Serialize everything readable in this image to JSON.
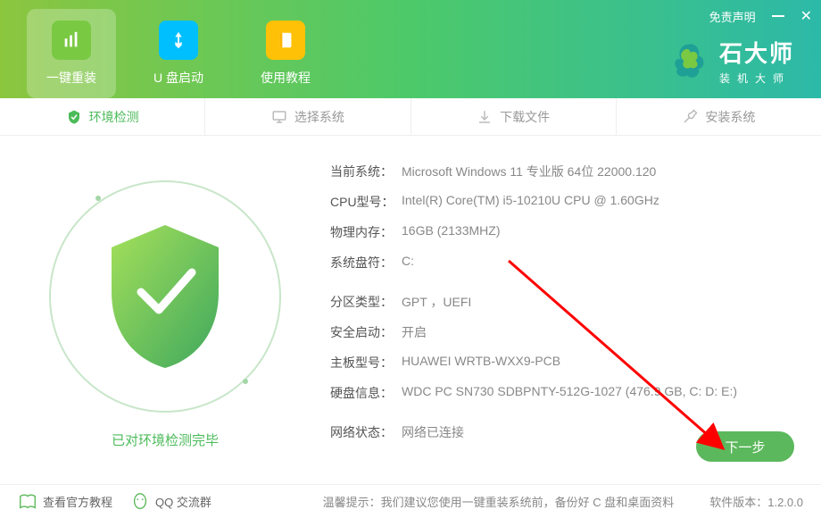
{
  "topbar": {
    "disclaimer": "免责声明"
  },
  "brand": {
    "title": "石大师",
    "subtitle": "装机大师"
  },
  "nav": {
    "reinstall": "一键重装",
    "usb": "U 盘启动",
    "tutorial": "使用教程"
  },
  "tabs": {
    "env": "环境检测",
    "select": "选择系统",
    "download": "下载文件",
    "install": "安装系统"
  },
  "status": "已对环境检测完毕",
  "info": {
    "os_label": "当前系统：",
    "os_value": "Microsoft Windows 11 专业版 64位 22000.120",
    "cpu_label": "CPU型号：",
    "cpu_value": "Intel(R) Core(TM) i5-10210U CPU @ 1.60GHz",
    "ram_label": "物理内存：",
    "ram_value": "16GB (2133MHZ)",
    "drive_label": "系统盘符：",
    "drive_value": "C:",
    "part_label": "分区类型：",
    "part_value": "GPT ，UEFI",
    "secure_label": "安全启动：",
    "secure_value": "开启",
    "board_label": "主板型号：",
    "board_value": "HUAWEI WRTB-WXX9-PCB",
    "disk_label": "硬盘信息：",
    "disk_value": "WDC PC SN730 SDBPNTY-512G-1027  (476.9 GB, C: D: E:)",
    "net_label": "网络状态：",
    "net_value": "网络已连接"
  },
  "buttons": {
    "next": "下一步"
  },
  "footer": {
    "tutorial": "查看官方教程",
    "qq": "QQ 交流群",
    "tip_label": "温馨提示：",
    "tip_text": "我们建议您使用一键重装系统前，备份好 C 盘和桌面资料",
    "ver_label": "软件版本：",
    "ver_value": "1.2.0.0"
  }
}
